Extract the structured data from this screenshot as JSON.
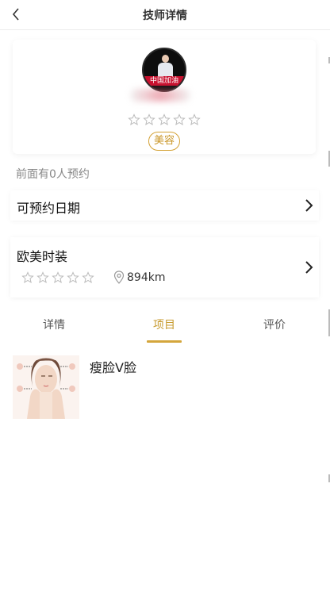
{
  "header": {
    "title": "技师详情",
    "back_icon": "chevron-left-icon"
  },
  "technician": {
    "avatar_banner": "中国加油",
    "rating_stars": 0,
    "max_stars": 5,
    "category": "美容"
  },
  "queue_text": "前面有0人预约",
  "booking": {
    "label": "可预约日期"
  },
  "shop": {
    "name": "欧美时装",
    "rating_stars": 0,
    "max_stars": 5,
    "distance": "894km"
  },
  "tabs": [
    {
      "label": "详情",
      "active": false
    },
    {
      "label": "项目",
      "active": true
    },
    {
      "label": "评价",
      "active": false
    }
  ],
  "projects": [
    {
      "name": "瘦脸V脸"
    }
  ],
  "colors": {
    "accent": "#d4a63c",
    "accent_text": "#c79a2c",
    "star_outline": "#bbbbbb"
  }
}
